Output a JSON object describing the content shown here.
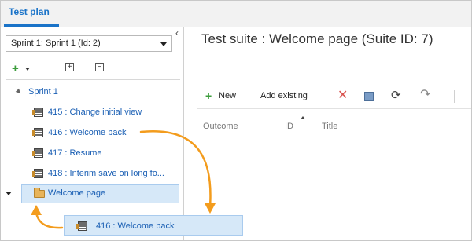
{
  "tabs": [
    {
      "label": "Test plan",
      "active": true
    }
  ],
  "left_pane": {
    "collapse_glyph": "‹",
    "sprint_select": {
      "value": "Sprint 1: Sprint 1 (Id: 2)"
    },
    "toolbar": {
      "add_icon": "plus-icon",
      "expand_all_icon": "expand-all-icon",
      "collapse_all_icon": "collapse-all-icon"
    },
    "tree": {
      "root": "Sprint 1",
      "cases": [
        "415 : Change initial view",
        "416 : Welcome back",
        "417 : Resume",
        "418 : Interim save on long fo..."
      ],
      "selected_suite": "Welcome page"
    }
  },
  "right_pane": {
    "suite_title": "Test suite : Welcome page (Suite ID: 7)",
    "toolbar": {
      "new_label": "New",
      "add_existing_label": "Add existing"
    },
    "columns": [
      "Outcome",
      "ID",
      "Title"
    ]
  },
  "drag_ghost": {
    "label": "416 : Welcome back"
  },
  "colors": {
    "accent": "#1a73c8",
    "link": "#1a5fb4",
    "selection": "#d6e8f8",
    "drag_arrow": "#f39c1d",
    "add_green": "#3c9d3c",
    "delete_red": "#d9534f"
  }
}
